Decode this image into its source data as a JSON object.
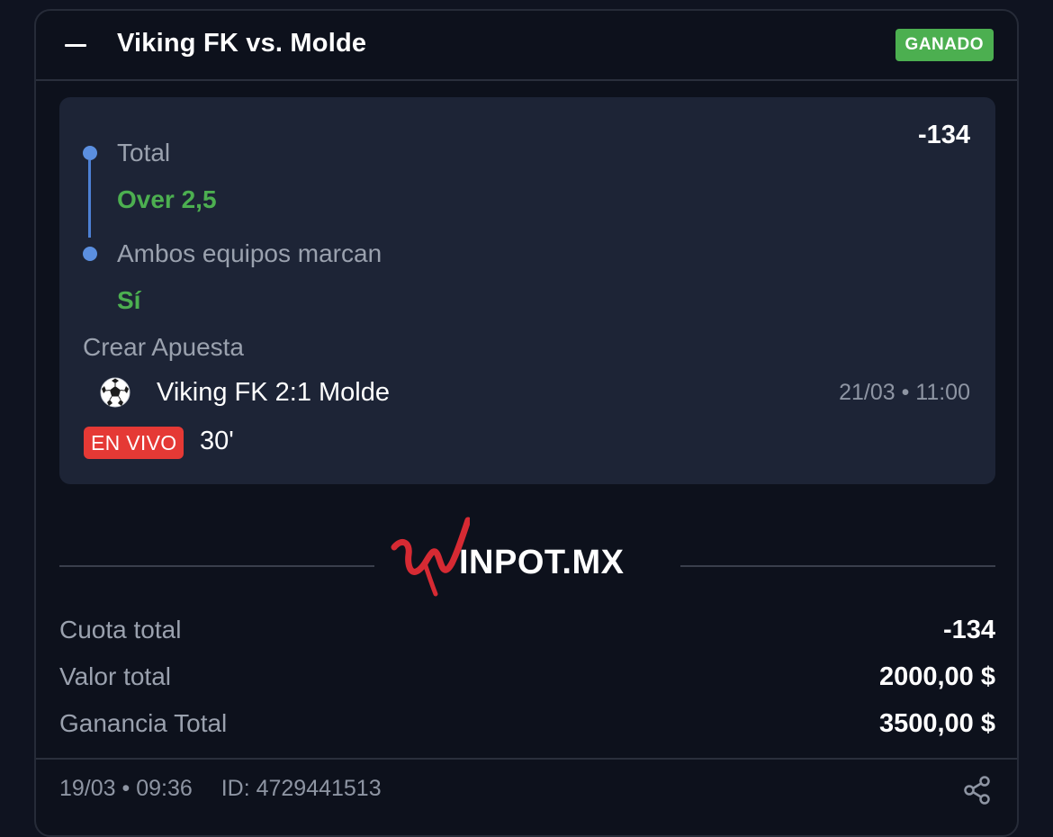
{
  "header": {
    "match_title": "Viking FK vs. Molde",
    "status": "GANADO",
    "status_color": "#4caf50"
  },
  "selections": [
    {
      "market": "Total",
      "pick": "Over 2,5"
    },
    {
      "market": "Ambos equipos marcan",
      "pick": "Sí"
    }
  ],
  "odds": "-134",
  "bet_type": "Crear Apuesta",
  "event": {
    "sport_icon": "soccer-ball-icon",
    "name": "Viking FK 2:1 Molde",
    "datetime": "21/03 • 11:00",
    "live_label": "EN VIVO",
    "live_minute": "30'"
  },
  "brand": {
    "name": "WINPOT.MX",
    "logo_rest": "INPOT.MX",
    "accent": "#d62a33"
  },
  "summary": [
    {
      "label": "Cuota total",
      "value": "-134"
    },
    {
      "label": "Valor total",
      "value": "2000,00 $"
    },
    {
      "label": "Ganancia Total",
      "value": "3500,00 $"
    }
  ],
  "footer": {
    "datetime": "19/03 • 09:36",
    "id_text": "ID: 4729441513",
    "share_icon": "share-icon"
  },
  "colors": {
    "background": "#0f1320",
    "card": "#0d111c",
    "panel": "#1d2436",
    "accent_blue": "#5b8fe0",
    "pick_green": "#4caf50",
    "live_red": "#e53935"
  }
}
